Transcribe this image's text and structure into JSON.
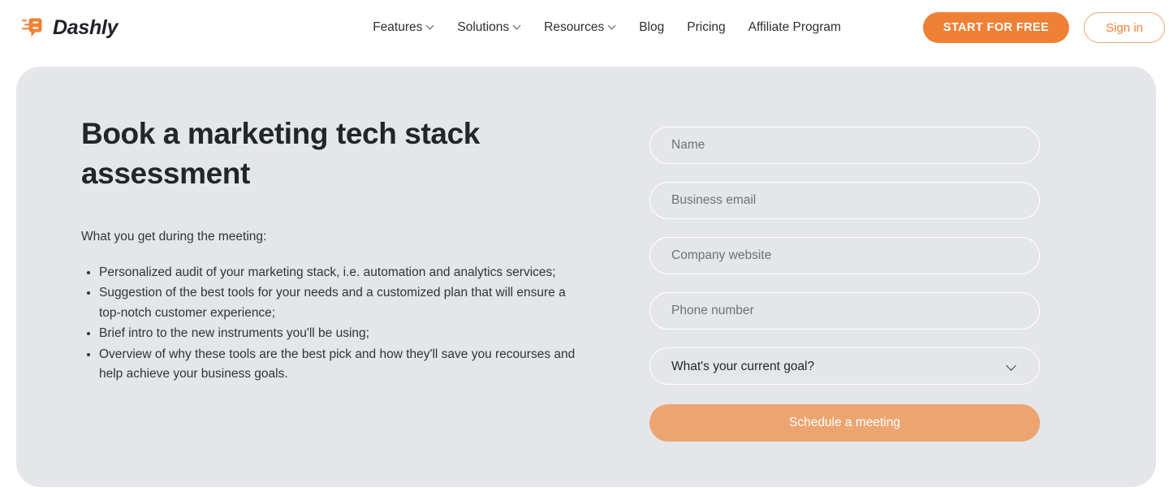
{
  "header": {
    "logo": {
      "icon": "dashly-speech-bubble-icon",
      "text": "Dashly",
      "accent_color": "#ef8137"
    },
    "nav": [
      {
        "label": "Features",
        "has_dropdown": true
      },
      {
        "label": "Solutions",
        "has_dropdown": true
      },
      {
        "label": "Resources",
        "has_dropdown": true
      },
      {
        "label": "Blog",
        "has_dropdown": false
      },
      {
        "label": "Pricing",
        "has_dropdown": false
      },
      {
        "label": "Affiliate Program",
        "has_dropdown": false
      }
    ],
    "start_button": "START FOR FREE",
    "signin_button": "Sign in"
  },
  "hero": {
    "headline": "Book a marketing tech stack assessment",
    "intro": "What you get during the meeting:",
    "bullets": [
      "Personalized audit of your marketing stack, i.e. automation and analytics services;",
      "Suggestion of the best tools for your needs and a customized plan that will ensure a top-notch customer experience;",
      "Brief intro to the new instruments you'll be using;",
      "Overview of why these tools are the best pick and how they'll save you recourses and help achieve your business goals."
    ],
    "panel_background": "#e4e6ea"
  },
  "form": {
    "fields": [
      {
        "name": "name",
        "placeholder": "Name",
        "value": ""
      },
      {
        "name": "business_email",
        "placeholder": "Business email",
        "value": ""
      },
      {
        "name": "company_website",
        "placeholder": "Company website",
        "value": ""
      },
      {
        "name": "phone_number",
        "placeholder": "Phone number",
        "value": ""
      }
    ],
    "select": {
      "label": "What's your current goal?",
      "selected": "What's your current goal?",
      "icon": "chevron-down-icon"
    },
    "submit_label": "Schedule a meeting",
    "submit_color": "#eca571"
  }
}
